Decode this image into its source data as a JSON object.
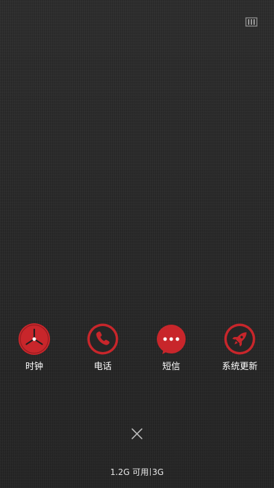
{
  "colors": {
    "accent": "#c8262b",
    "background": "#2b2b2b",
    "text": "#ffffff"
  },
  "status_bar": {
    "icon": "lock-screen-icon"
  },
  "apps": [
    {
      "label": "时钟",
      "icon": "clock-icon"
    },
    {
      "label": "电话",
      "icon": "phone-icon"
    },
    {
      "label": "短信",
      "icon": "message-icon"
    },
    {
      "label": "系统更新",
      "icon": "rocket-icon"
    }
  ],
  "close_icon": "close-icon",
  "memory": {
    "available": "1.2G 可用",
    "network": "3G"
  }
}
